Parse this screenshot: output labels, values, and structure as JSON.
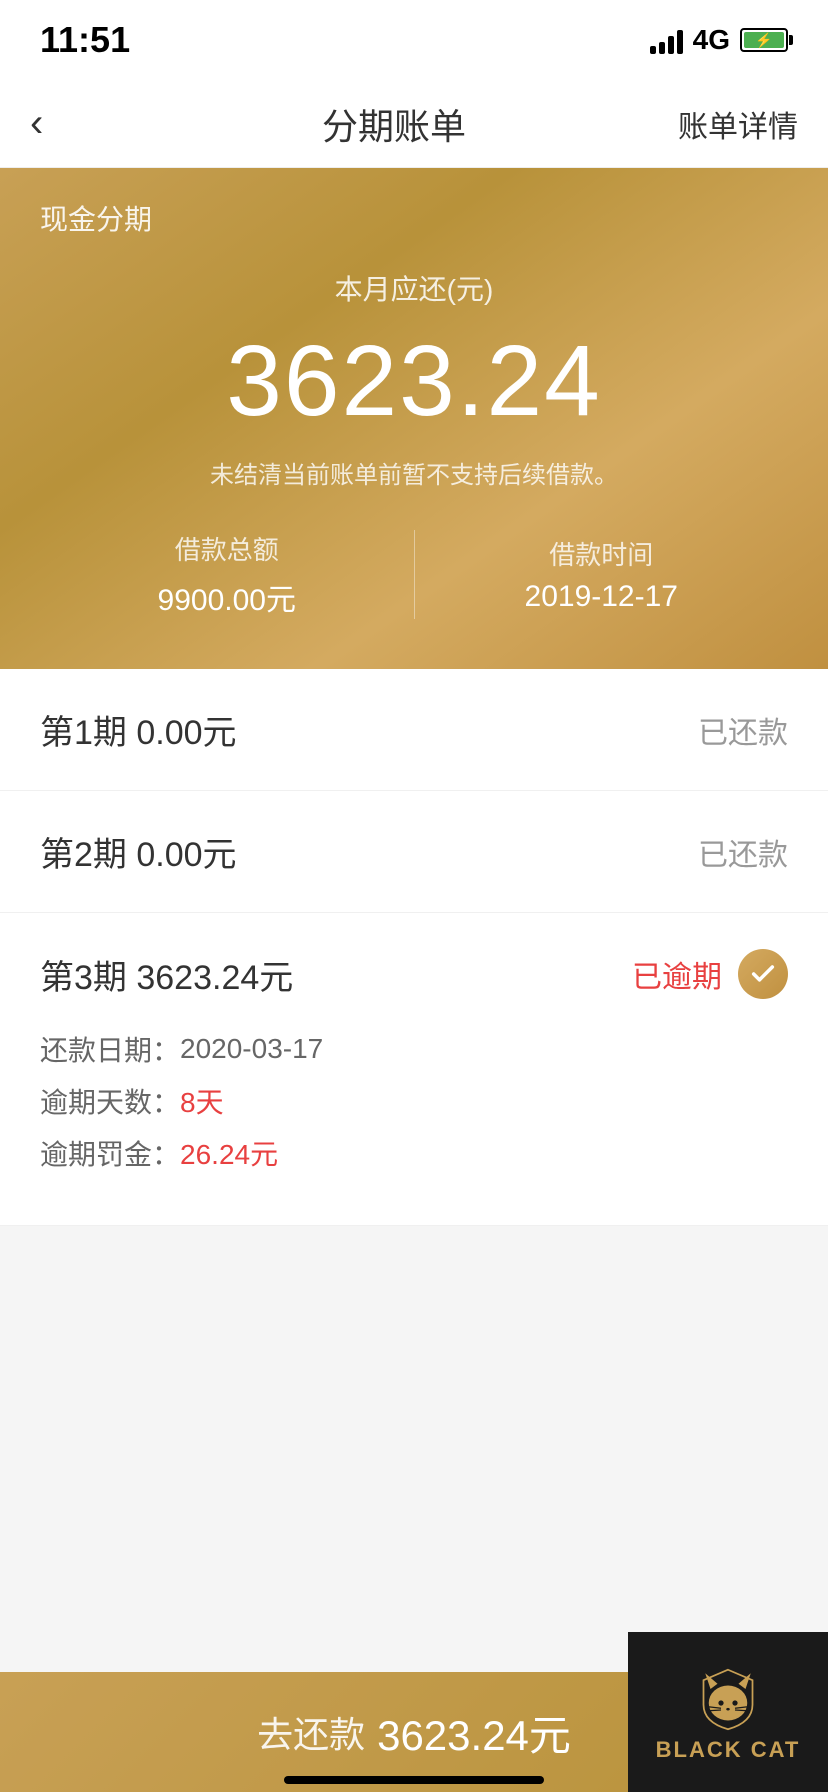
{
  "statusBar": {
    "time": "11:51",
    "network": "4G"
  },
  "navBar": {
    "backLabel": "‹",
    "title": "分期账单",
    "detailLabel": "账单详情"
  },
  "hero": {
    "sectionLabel": "现金分期",
    "amountSubtitle": "本月应还(元)",
    "amount": "3623.24",
    "warning": "未结清当前账单前暂不支持后续借款。",
    "loanAmountLabel": "借款总额",
    "loanAmount": "9900.00元",
    "loanDateLabel": "借款时间",
    "loanDate": "2019-12-17"
  },
  "installments": [
    {
      "period": "第1期  0.00元",
      "status": "已还款",
      "overdue": false,
      "expanded": false
    },
    {
      "period": "第2期  0.00元",
      "status": "已还款",
      "overdue": false,
      "expanded": false
    },
    {
      "period": "第3期  3623.24元",
      "status": "已逾期",
      "overdue": true,
      "expanded": true,
      "repayDate": "还款日期：",
      "repayDateValue": "2020-03-17",
      "overdueDaysLabel": "逾期天数：",
      "overdueDaysValue": "8天",
      "overdueFineLabel": "逾期罚金：",
      "overdueFineValue": "26.24元"
    }
  ],
  "bottomBar": {
    "payLabel": "去还款",
    "payAmount": "3623.24元"
  },
  "blackCat": {
    "label": "BLACK CAT"
  }
}
